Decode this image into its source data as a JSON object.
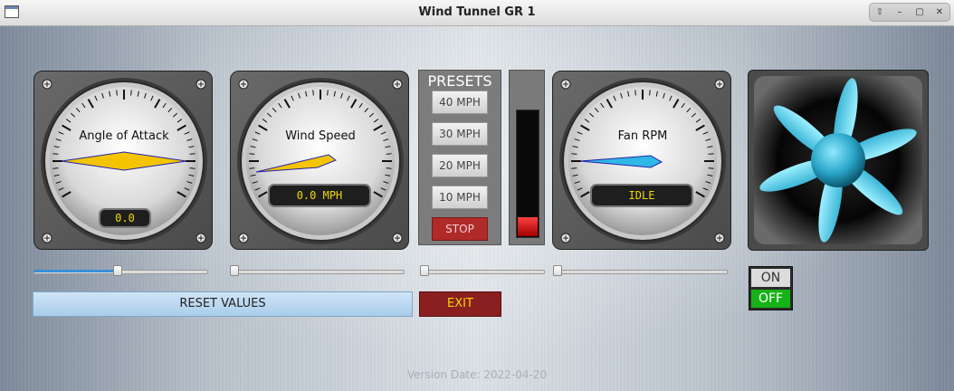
{
  "window": {
    "title": "Wind Tunnel GR 1"
  },
  "gauges": {
    "aoa": {
      "label": "Angle of Attack",
      "readout": "0.0"
    },
    "wind": {
      "label": "Wind Speed",
      "readout": "0.0 MPH"
    },
    "fan": {
      "label": "Fan RPM",
      "readout": "IDLE"
    }
  },
  "presets": {
    "title": "PRESETS",
    "buttons": [
      "40 MPH",
      "30 MPH",
      "20 MPH",
      "10 MPH"
    ],
    "stop": "STOP"
  },
  "sliders": {
    "aoa_level": 0.48,
    "wind_level": 0.0,
    "presets_level": 0.0,
    "fan_level": 0.0
  },
  "meter": {
    "level": 0.15
  },
  "buttons": {
    "reset": "RESET VALUES",
    "exit": "EXIT"
  },
  "toggle": {
    "on": "ON",
    "off": "OFF",
    "selected": "OFF"
  },
  "footer": {
    "version": "Version Date: 2022-04-20"
  },
  "colors": {
    "accent_yellow": "#f0d800",
    "slider_blue": "#3c8fd6",
    "stop_red": "#b02a2a",
    "off_green": "#16b316",
    "fan_blue": "#5bd4f0"
  }
}
